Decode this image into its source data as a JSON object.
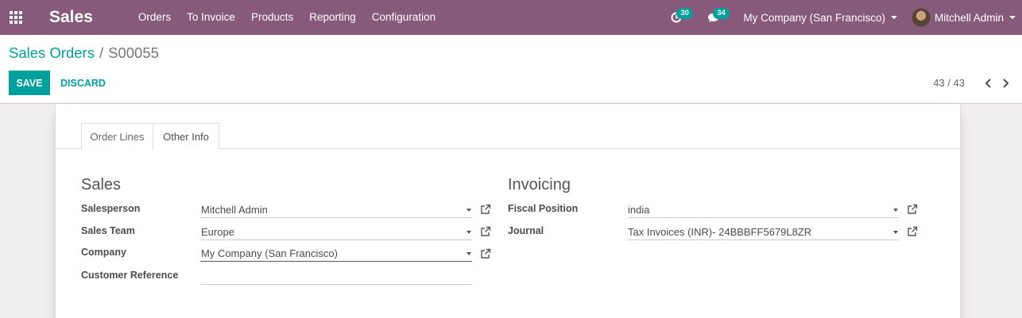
{
  "navbar": {
    "app_name": "Sales",
    "menu": [
      "Orders",
      "To Invoice",
      "Products",
      "Reporting",
      "Configuration"
    ],
    "activity_count": "30",
    "message_count": "34",
    "company": "My Company (San Francisco)",
    "user": "Mitchell Admin",
    "color": "#875a7b"
  },
  "control_panel": {
    "breadcrumb_parent": "Sales Orders",
    "breadcrumb_separator": "/",
    "breadcrumb_current": "S00055",
    "save_label": "SAVE",
    "discard_label": "DISCARD",
    "pager_value": "43 / 43",
    "accent": "#00a09d"
  },
  "tabs": [
    {
      "label": "Order Lines",
      "active": false
    },
    {
      "label": "Other Info",
      "active": true
    }
  ],
  "sales_group": {
    "title": "Sales",
    "fields": [
      {
        "label": "Salesperson",
        "value": "Mitchell Admin"
      },
      {
        "label": "Sales Team",
        "value": "Europe"
      },
      {
        "label": "Company",
        "value": "My Company (San Francisco)"
      },
      {
        "label": "Customer Reference",
        "value": ""
      }
    ]
  },
  "invoicing_group": {
    "title": "Invoicing",
    "fields": [
      {
        "label": "Fiscal Position",
        "value": "india"
      },
      {
        "label": "Journal",
        "value": "Tax Invoices (INR)- 24BBBFF5679L8ZR"
      }
    ]
  }
}
